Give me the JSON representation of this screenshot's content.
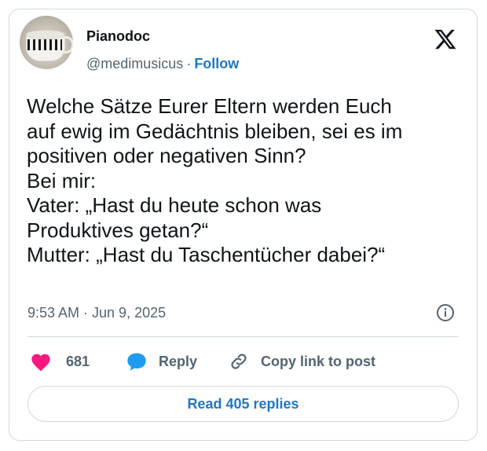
{
  "author": {
    "display_name": "Pianodoc",
    "handle": "@medimusicus",
    "separator": "·",
    "follow_label": "Follow"
  },
  "tweet": {
    "text": "Welche Sätze Eurer Eltern werden Euch\nauf ewig im Gedächtnis bleiben, sei es im\npositiven oder negativen Sinn?\nBei mir:\nVater: „Hast du heute schon was\nProduktives getan?“\nMutter: „Hast du Taschentücher dabei?“",
    "timestamp": "9:53 AM · Jun 9, 2025"
  },
  "actions": {
    "like_count": "681",
    "reply_label": "Reply",
    "copy_label": "Copy link to post"
  },
  "read_replies_label": "Read 405 replies",
  "icons": {
    "like": "heart-icon",
    "reply": "speech-bubble-icon",
    "copy": "link-icon",
    "info": "info-icon",
    "brand": "x-logo-icon"
  },
  "colors": {
    "accent": "#1d77c6",
    "like": "#f91880",
    "reply": "#1d9bf0",
    "muted": "#536471",
    "border": "#cfd9de"
  }
}
